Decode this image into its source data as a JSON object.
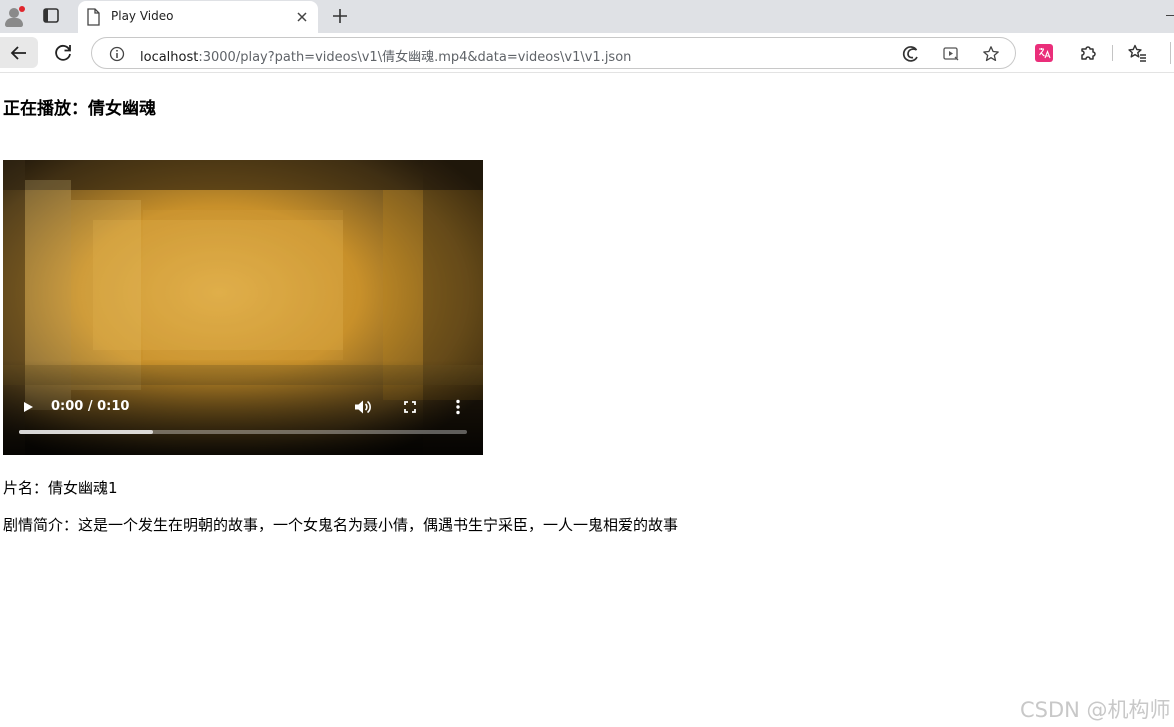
{
  "browser": {
    "tab_title": "Play Video",
    "url_host": "localhost",
    "url_rest": ":3000/play?path=videos\\v1\\倩女幽魂.mp4&data=videos\\v1\\v1.json"
  },
  "page": {
    "heading": "正在播放：倩女幽魂",
    "video": {
      "time_display": "0:00 / 0:10",
      "buffered_fraction": 0.3
    },
    "title_line": "片名：倩女幽魂1",
    "plot_line": "剧情简介：这是一个发生在明朝的故事，一个女鬼名为聂小倩，偶遇书生宁采臣，一人一鬼相爱的故事"
  },
  "watermark": "CSDN @机构师"
}
